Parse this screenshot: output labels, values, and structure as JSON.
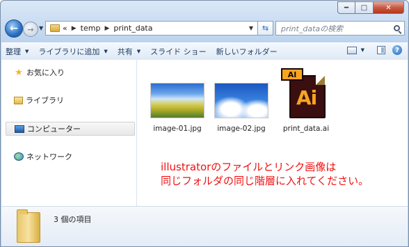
{
  "window": {
    "controls": {
      "minimize": "━",
      "maximize": "□",
      "close": "✕"
    }
  },
  "address_bar": {
    "overflow": "«",
    "crumbs": [
      "temp",
      "print_data"
    ],
    "search_placeholder": "print_dataの検索"
  },
  "toolbar": {
    "organize": "整理",
    "add_to_library": "ライブラリに追加",
    "share": "共有",
    "slideshow": "スライド ショー",
    "new_folder": "新しいフォルダー"
  },
  "sidebar": {
    "items": [
      {
        "label": "お気に入り",
        "icon": "star-icon"
      },
      {
        "label": "ライブラリ",
        "icon": "library-icon"
      },
      {
        "label": "コンピューター",
        "icon": "computer-icon"
      },
      {
        "label": "ネットワーク",
        "icon": "network-icon"
      }
    ]
  },
  "files": [
    {
      "name": "image-01.jpg",
      "kind": "photo"
    },
    {
      "name": "image-02.jpg",
      "kind": "photo"
    },
    {
      "name": "print_data.ai",
      "kind": "illustrator",
      "badge": "AI",
      "icon_text": "Ai"
    }
  ],
  "note": {
    "line1": "illustratorのファイルとリンク画像は",
    "line2": "同じフォルダの同じ階層に入れてください。",
    "color": "#f01010"
  },
  "status": {
    "count": "3 個の項目"
  }
}
